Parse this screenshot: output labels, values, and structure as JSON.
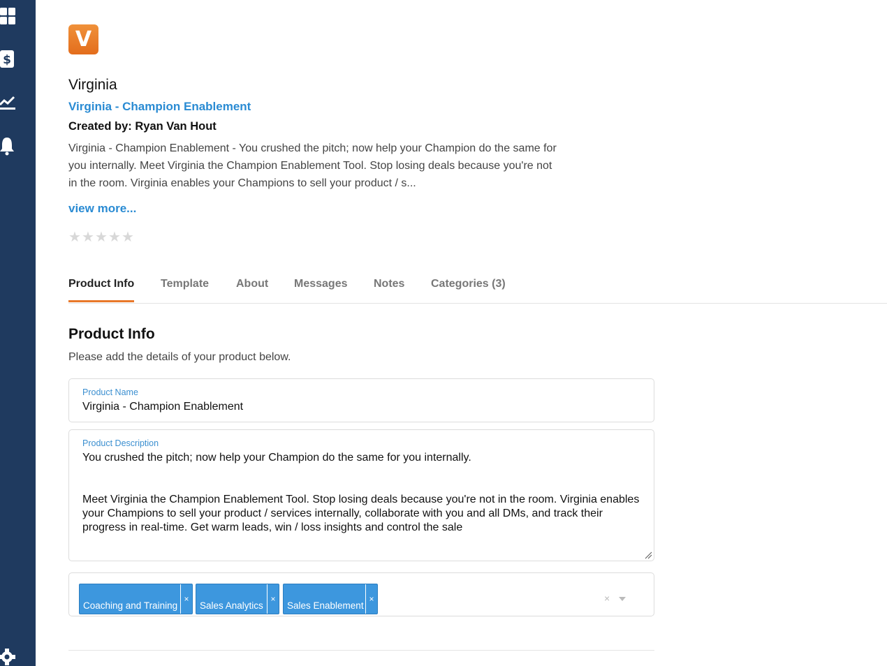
{
  "sidebar": {
    "icons": [
      "dashboard-icon",
      "dollar-icon",
      "analytics-icon",
      "bell-icon",
      "gear-icon"
    ]
  },
  "product": {
    "logo_letter": "V",
    "title": "Virginia",
    "link": "Virginia - Champion Enablement",
    "created_by": "Created by: Ryan Van Hout",
    "summary": "Virginia - Champion Enablement - You crushed the pitch; now help your Champion do the same for you internally. Meet Virginia the Champion Enablement Tool. Stop losing deals because you're not in the room. Virginia enables your Champions to sell your product / s...",
    "view_more": "view more...",
    "rating": 0,
    "rating_max": 5
  },
  "tabs": [
    {
      "label": "Product Info",
      "active": true
    },
    {
      "label": "Template",
      "active": false
    },
    {
      "label": "About",
      "active": false
    },
    {
      "label": "Messages",
      "active": false
    },
    {
      "label": "Notes",
      "active": false
    },
    {
      "label": "Categories (3)",
      "active": false
    }
  ],
  "section": {
    "title": "Product Info",
    "subtitle": "Please add the details of your product below."
  },
  "form": {
    "name_label": "Product Name",
    "name_value": "Virginia - Champion Enablement",
    "description_label": "Product Description",
    "description_value": "You crushed the pitch; now help your Champion do the same for you internally.\n\n\nMeet Virginia the Champion Enablement Tool. Stop losing deals because you're not in the room. Virginia enables your Champions to sell your product / services internally, collaborate with you and all DMs, and track their progress in real-time. Get warm leads, win / loss insights and control the sale",
    "tags": [
      "Coaching and Training",
      "Sales Analytics",
      "Sales Enablement"
    ],
    "tag_remove": "×",
    "clear_all": "×"
  },
  "colors": {
    "sidebar": "#1f3a5f",
    "accent_blue": "#2a8bd3",
    "tab_underline": "#e8782a",
    "logo": "#e8782a",
    "tag_bg": "#3d97de"
  }
}
